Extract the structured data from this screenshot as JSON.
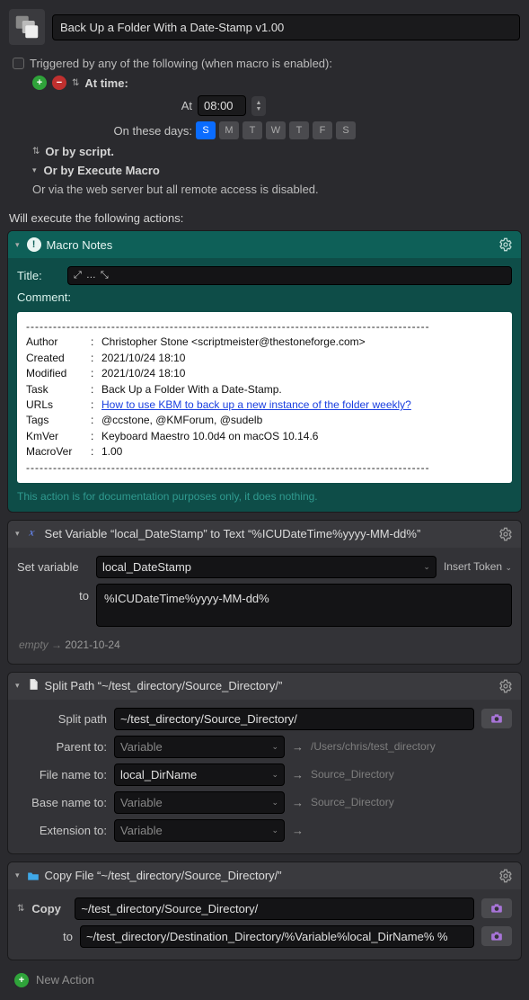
{
  "header": {
    "macro_title": "Back Up a Folder With a Date-Stamp v1.00"
  },
  "triggers": {
    "triggered_by_label": "Triggered by any of the following (when macro is enabled):",
    "at_time_label": "At time:",
    "at_label": "At",
    "time_value": "08:00",
    "on_days_label": "On these days:",
    "days": [
      "S",
      "M",
      "T",
      "W",
      "T",
      "F",
      "S"
    ],
    "day_active_index": 0,
    "or_by_script": "Or by script.",
    "or_by_execute_macro": "Or by Execute Macro",
    "or_via_web": "Or via the web server but all remote access is disabled."
  },
  "exec_label": "Will execute the following actions:",
  "action_notes": {
    "header": "Macro Notes",
    "title_label": "Title:",
    "title_resize_glyph": "⤢ … ⤡",
    "comment_label": "Comment:",
    "fields": {
      "Author": "Christopher Stone <scriptmeister@thestoneforge.com>",
      "Created": "2021/10/24 18:10",
      "Modified": "2021/10/24 18:10",
      "Task": "Back Up a Folder With a Date-Stamp.",
      "URLs_label": "URLs",
      "URLs_link": "How to use KBM to back up a new instance of the folder weekly?",
      "Tags": "@ccstone, @KMForum, @sudelb",
      "KmVer": "Keyboard Maestro 10.0d4 on macOS 10.14.6",
      "MacroVer": "1.00"
    },
    "footer": "This action is for documentation purposes only, it does nothing."
  },
  "action_setvar": {
    "header": "Set Variable “local_DateStamp” to Text “%ICUDateTime%yyyy-MM-dd%”",
    "set_variable_label": "Set variable",
    "variable_name": "local_DateStamp",
    "insert_token_label": "Insert Token",
    "to_label": "to",
    "to_value": "%ICUDateTime%yyyy-MM-dd%",
    "result_empty": "empty",
    "result_value": "2021-10-24"
  },
  "action_split": {
    "header": "Split Path “~/test_directory/Source_Directory/”",
    "split_path_label": "Split path",
    "split_path_value": "~/test_directory/Source_Directory/",
    "parent_label": "Parent to:",
    "parent_var_placeholder": "Variable",
    "parent_preview": "/Users/chris/test_directory",
    "filename_label": "File name to:",
    "filename_var": "local_DirName",
    "filename_preview": "Source_Directory",
    "basename_label": "Base name to:",
    "basename_var_placeholder": "Variable",
    "basename_preview": "Source_Directory",
    "extension_label": "Extension to:",
    "extension_var_placeholder": "Variable"
  },
  "action_copy": {
    "header": "Copy File “~/test_directory/Source_Directory/”",
    "copy_label": "Copy",
    "copy_value": "~/test_directory/Source_Directory/",
    "to_label": "to",
    "to_value": "~/test_directory/Destination_Directory/%Variable%local_DirName% %"
  },
  "new_action_label": "New Action"
}
